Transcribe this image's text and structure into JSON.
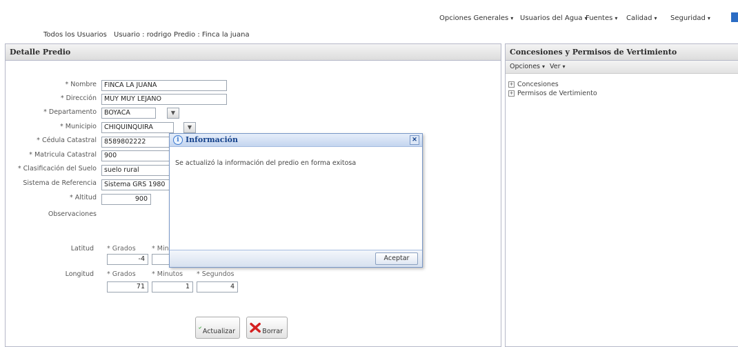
{
  "top_nav": [
    {
      "label": "Opciones Generales"
    },
    {
      "label": "Usuarios del Agua"
    },
    {
      "label": "Fuentes"
    },
    {
      "label": "Calidad"
    },
    {
      "label": "Seguridad"
    }
  ],
  "breadcrumb": {
    "all_users": "Todos los Usuarios",
    "user": "Usuario : rodrigo",
    "predio": "Predio : Finca la juana"
  },
  "detail_panel": {
    "title": "Detalle Predio",
    "fields": {
      "nombre": {
        "label": "* Nombre",
        "value": "FINCA LA JUANA"
      },
      "direccion": {
        "label": "* Dirección",
        "value": "MUY MUY LEJANO"
      },
      "departamento": {
        "label": "* Departamento",
        "value": "BOYACA"
      },
      "municipio": {
        "label": "* Municipio",
        "value": "CHIQUINQUIRA"
      },
      "cedula": {
        "label": "* Cédula Catastral",
        "value": "8589802222"
      },
      "matricula": {
        "label": "* Matricula Catastral",
        "value": "900"
      },
      "clasificacion": {
        "label": "* Clasificación del Suelo",
        "value": "suelo rural"
      },
      "sistema": {
        "label": "Sistema de Referencia",
        "value": "Sistema GRS 1980"
      },
      "altitud": {
        "label": "* Altitud",
        "value": "900"
      },
      "observaciones": {
        "label": "Observaciones"
      }
    },
    "latitud": {
      "label": "Latitud",
      "grados_label": "* Grados",
      "minutos_label": "* Minutos",
      "grados": "-4"
    },
    "longitud": {
      "label": "Longitud",
      "grados_label": "* Grados",
      "minutos_label": "* Minutos",
      "segundos_label": "* Segundos",
      "grados": "71",
      "minutos": "1",
      "segundos": "4"
    },
    "buttons": {
      "actualizar": "Actualizar",
      "borrar": "Borrar"
    }
  },
  "concesiones_panel": {
    "title": "Concesiones y Permisos de Vertimiento",
    "toolbar": {
      "opciones": "Opciones",
      "ver": "Ver"
    },
    "tree": [
      {
        "label": "Concesiones"
      },
      {
        "label": "Permisos de Vertimiento"
      }
    ]
  },
  "dialog": {
    "title": "Información",
    "message": "Se actualizó la información del predio en forma exitosa",
    "accept": "Aceptar"
  },
  "colors": {
    "dialog_title": "#15428b",
    "info_icon": "#3a78d0",
    "delete_icon": "#d42020",
    "save_icon": "#3caa3c"
  }
}
